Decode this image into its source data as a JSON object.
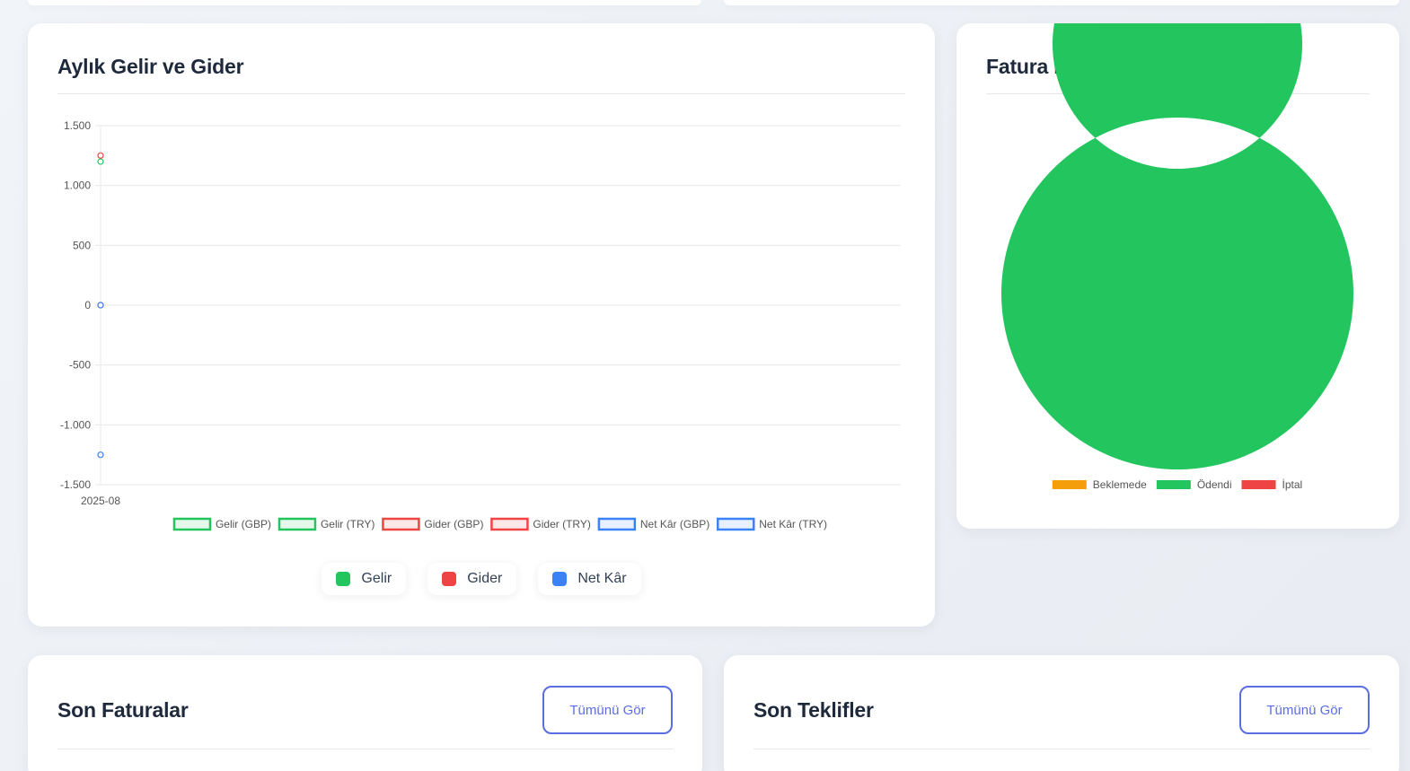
{
  "income_card": {
    "title": "Aylık Gelir ve Gider",
    "pills": [
      {
        "label": "Gelir",
        "color": "#22c55e"
      },
      {
        "label": "Gider",
        "color": "#ef4444"
      },
      {
        "label": "Net Kâr",
        "color": "#3b82f6"
      }
    ]
  },
  "invoice_card": {
    "title": "Fatura Durumları"
  },
  "recent_invoices": {
    "title": "Son Faturalar",
    "button_label": "Tümünü Gör"
  },
  "recent_quotes": {
    "title": "Son Teklifler",
    "button_label": "Tümünü Gör"
  },
  "chart_data": [
    {
      "type": "line",
      "x": [
        "2025-08"
      ],
      "ylim": [
        -1500,
        1500
      ],
      "yticks": [
        1500,
        1000,
        500,
        0,
        -500,
        -1000,
        -1500
      ],
      "ytick_labels": [
        "1.500",
        "1.000",
        "500",
        "0",
        "-500",
        "-1.000",
        "-1.500"
      ],
      "grid": true,
      "legend_position": "bottom",
      "series": [
        {
          "name": "Gelir (GBP)",
          "color": "#22c55e",
          "values": [
            0
          ]
        },
        {
          "name": "Gelir (TRY)",
          "color": "#22c55e",
          "values": [
            1200
          ]
        },
        {
          "name": "Gider (GBP)",
          "color": "#ef4444",
          "values": [
            0
          ]
        },
        {
          "name": "Gider (TRY)",
          "color": "#ef4444",
          "values": [
            1250
          ]
        },
        {
          "name": "Net Kâr (GBP)",
          "color": "#3b82f6",
          "values": [
            0
          ]
        },
        {
          "name": "Net Kâr (TRY)",
          "color": "#3b82f6",
          "values": [
            -1250
          ]
        }
      ]
    },
    {
      "type": "pie",
      "donut": true,
      "legend_position": "bottom",
      "categories": [
        "Beklemede",
        "Ödendi",
        "İptal"
      ],
      "values": [
        0,
        1,
        0
      ],
      "colors": [
        "#f59e0b",
        "#22c55e",
        "#ef4444"
      ]
    }
  ]
}
